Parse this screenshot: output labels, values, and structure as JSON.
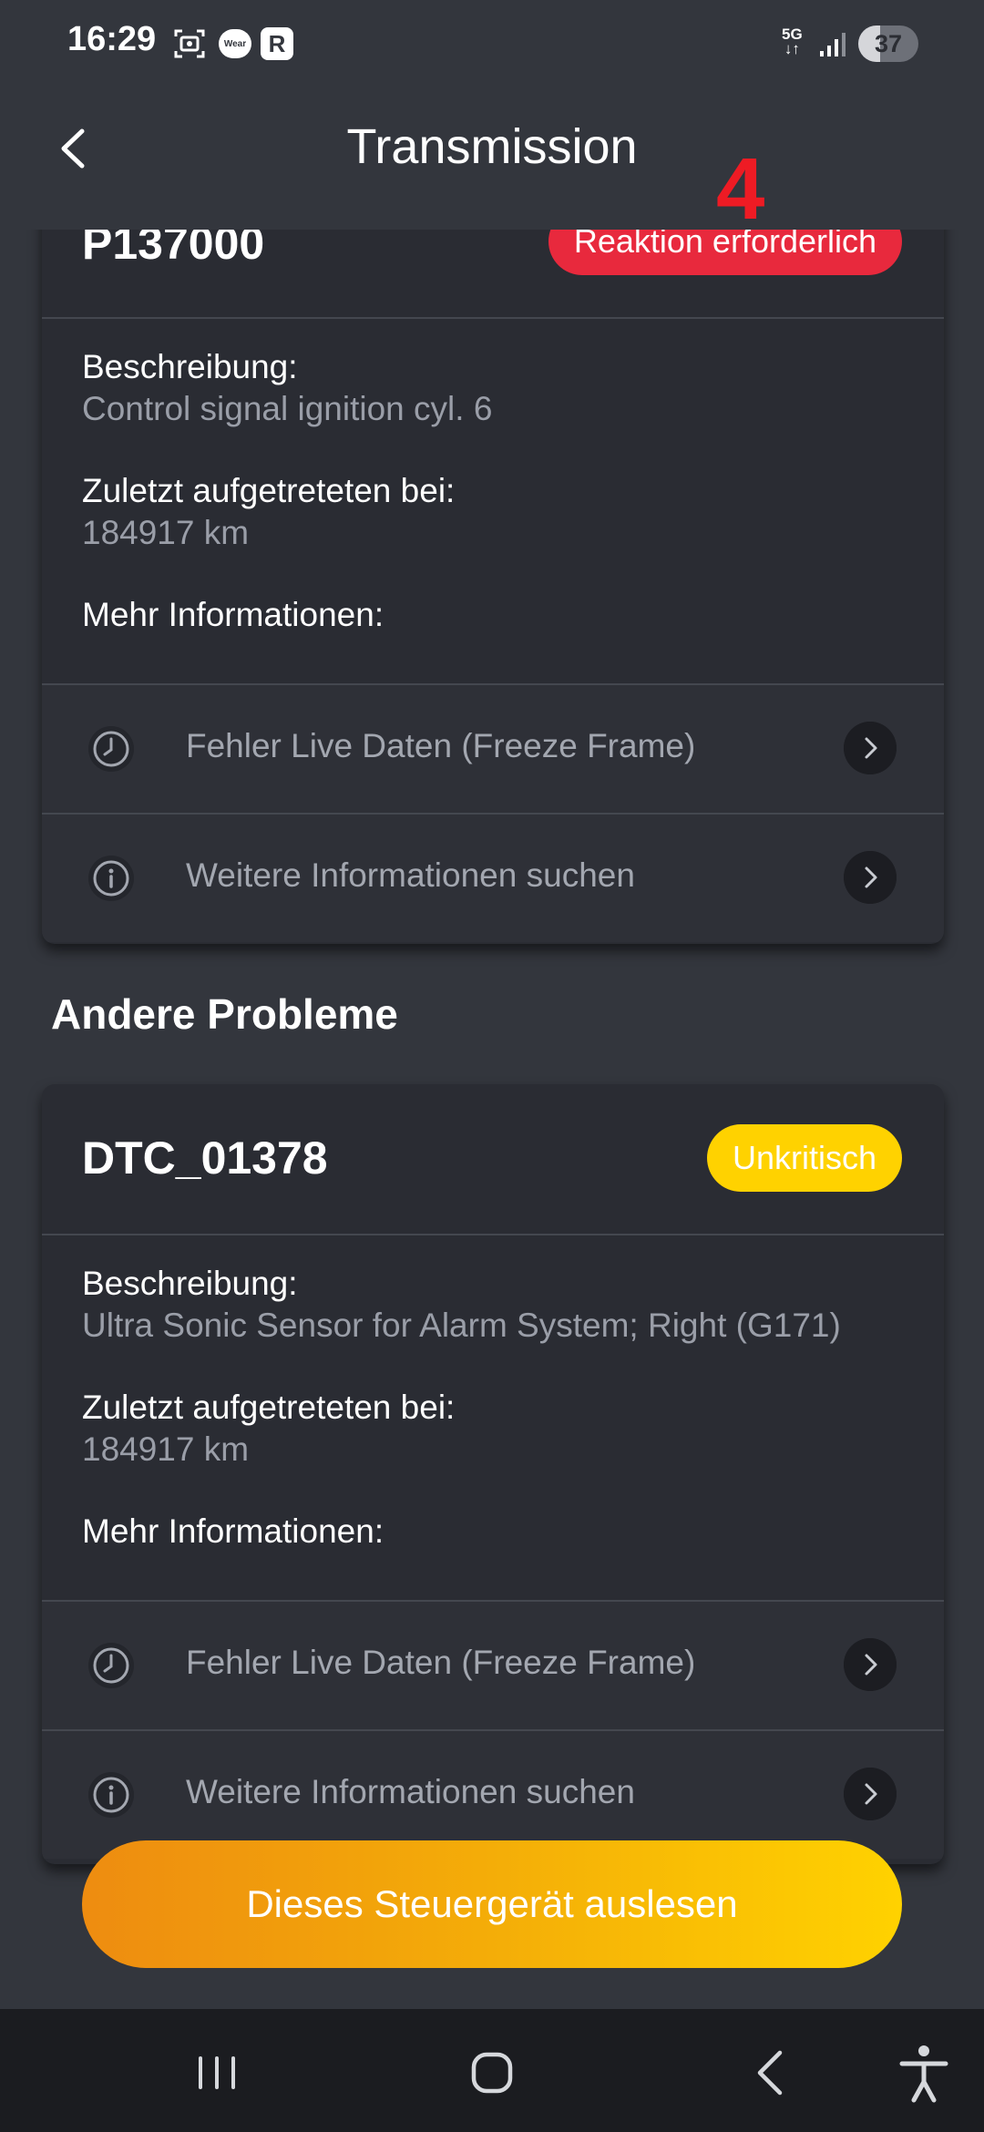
{
  "status_bar": {
    "time": "16:29",
    "wear_label": "Wear",
    "r_label": "R",
    "network": "5G",
    "battery": "37",
    "battery_level": 0.37
  },
  "header": {
    "title": "Transmission",
    "annotation": "4"
  },
  "cards": [
    {
      "code": "P137000",
      "badge": "Reaktion erforderlich",
      "badge_color": "#e8293d",
      "description_label": "Beschreibung:",
      "description": "Control signal ignition cyl. 6",
      "last_seen_label": "Zuletzt aufgetreteten bei:",
      "last_seen": "184917 km",
      "more_label": "Mehr Informationen:",
      "freeze_frame": "Fehler Live Daten (Freeze Frame)",
      "search_info": "Weitere Informationen suchen"
    },
    {
      "code": "DTC_01378",
      "badge": "Unkritisch",
      "badge_color": "#ffd200",
      "description_label": "Beschreibung:",
      "description": "Ultra Sonic Sensor for Alarm System; Right (G171)",
      "last_seen_label": "Zuletzt aufgetreteten bei:",
      "last_seen": "184917 km",
      "more_label": "Mehr Informationen:",
      "freeze_frame": "Fehler Live Daten (Freeze Frame)",
      "search_info": "Weitere Informationen suchen"
    }
  ],
  "section_title": "Andere Probleme",
  "cta_label": "Dieses Steuergerät auslesen",
  "colors": {
    "background": "#33363d",
    "card": "#2a2c33",
    "accent_orange": "#ee8c10",
    "accent_yellow": "#ffd200",
    "alert_red": "#e8293d",
    "annotation_red": "#ee1b24"
  }
}
